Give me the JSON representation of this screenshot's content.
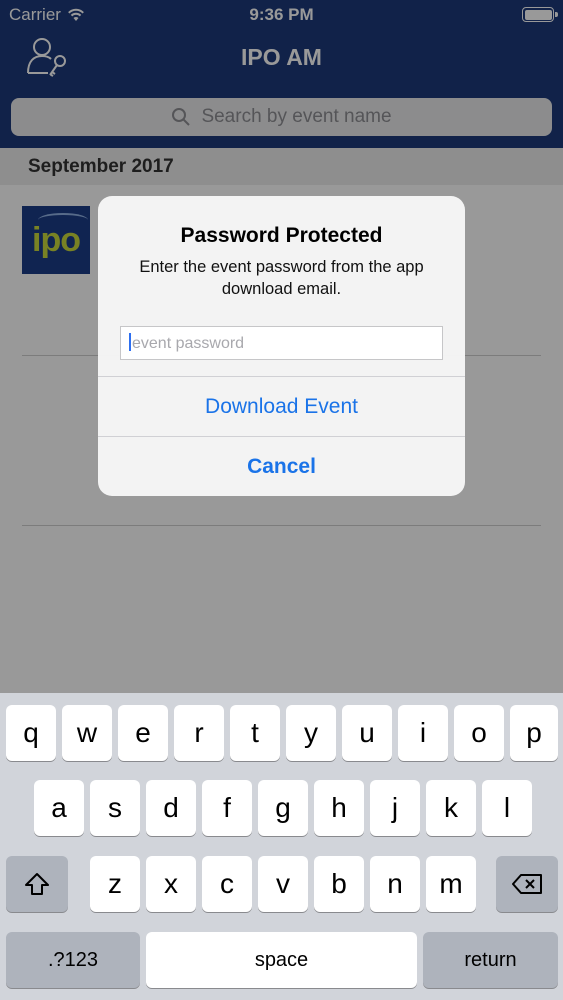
{
  "status_bar": {
    "carrier": "Carrier",
    "time": "9:36 PM"
  },
  "nav": {
    "title": "IPO AM",
    "left_icon": "user-key-icon"
  },
  "search": {
    "placeholder": "Search by event name"
  },
  "list": {
    "section_header": "September 2017",
    "events": [
      {
        "logo_text": "ipo"
      }
    ]
  },
  "alert": {
    "title": "Password Protected",
    "message": "Enter the event password from the app download email.",
    "input_placeholder": "event password",
    "buttons": {
      "download": "Download Event",
      "cancel": "Cancel"
    }
  },
  "keyboard": {
    "row1": [
      "q",
      "w",
      "e",
      "r",
      "t",
      "y",
      "u",
      "i",
      "o",
      "p"
    ],
    "row2": [
      "a",
      "s",
      "d",
      "f",
      "g",
      "h",
      "j",
      "k",
      "l"
    ],
    "row3": [
      "z",
      "x",
      "c",
      "v",
      "b",
      "n",
      "m"
    ],
    "shift_icon": "shift-icon",
    "delete_icon": "backspace-icon",
    "numbers_label": ".?123",
    "space_label": "space",
    "return_label": "return"
  },
  "colors": {
    "nav_bg": "#1d3a7a",
    "link_blue": "#1a73e8",
    "keyboard_bg": "#d1d4da"
  }
}
